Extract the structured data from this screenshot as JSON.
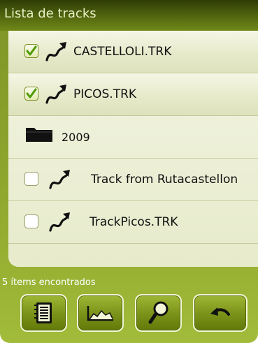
{
  "header": {
    "title": "Lista de tracks"
  },
  "items": [
    {
      "label": "CASTELLOLI.TRK",
      "type": "track",
      "checked": true
    },
    {
      "label": "PICOS.TRK",
      "type": "track",
      "checked": true
    },
    {
      "label": "2009",
      "type": "folder",
      "checked": null
    },
    {
      "label": "Track from Rutacastellon",
      "type": "track",
      "checked": false
    },
    {
      "label": "TrackPicos.TRK",
      "type": "track",
      "checked": false
    }
  ],
  "status": {
    "text": "5 ítems encontrados"
  },
  "toolbar": {
    "buttons": [
      {
        "icon": "document-list-icon"
      },
      {
        "icon": "elevation-profile-icon"
      },
      {
        "icon": "magnifier-icon"
      },
      {
        "icon": "undo-arrow-icon"
      }
    ]
  },
  "colors": {
    "header": "#3b4a0a",
    "panel": "#8da52c",
    "list_bg": "#eef0d9",
    "check_green": "#4e9a06"
  }
}
